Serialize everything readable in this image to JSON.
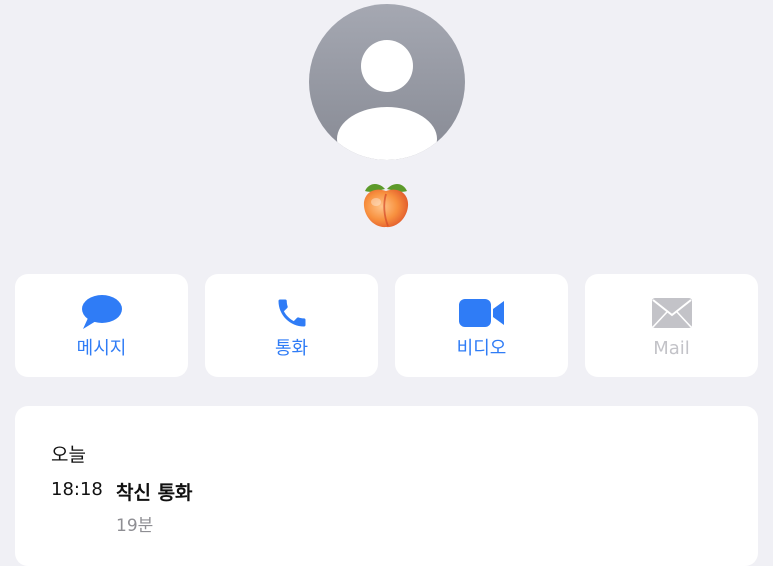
{
  "contact": {
    "avatar_icon": "person-placeholder-icon",
    "name_icon": "peach-emoji-icon"
  },
  "actions": [
    {
      "label": "메시지",
      "icon": "message-bubble-icon",
      "enabled": true
    },
    {
      "label": "통화",
      "icon": "phone-icon",
      "enabled": true
    },
    {
      "label": "비디오",
      "icon": "video-camera-icon",
      "enabled": true
    },
    {
      "label": "Mail",
      "icon": "mail-envelope-icon",
      "enabled": false
    }
  ],
  "history": {
    "date_label": "오늘",
    "entries": [
      {
        "time": "18:18",
        "type": "착신 통화",
        "duration": "19분"
      }
    ]
  },
  "colors": {
    "accent": "#2f7cf6",
    "disabled": "#c3c3c8",
    "background": "#f0f0f5",
    "card": "#ffffff",
    "secondary_text": "#8e8e93"
  }
}
